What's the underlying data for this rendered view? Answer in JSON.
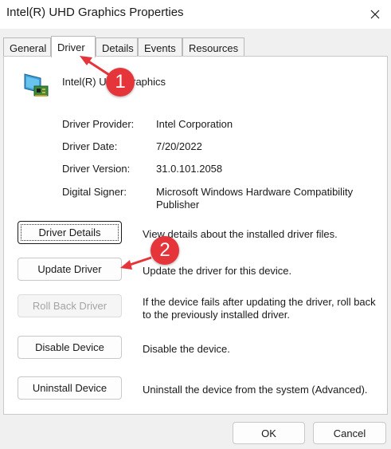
{
  "window": {
    "title": "Intel(R) UHD Graphics Properties"
  },
  "tabs": [
    {
      "label": "General"
    },
    {
      "label": "Driver"
    },
    {
      "label": "Details"
    },
    {
      "label": "Events"
    },
    {
      "label": "Resources"
    }
  ],
  "device": {
    "name": "Intel(R) UHD Graphics",
    "icon": "display-adapter-icon"
  },
  "info": {
    "provider_label": "Driver Provider:",
    "provider_value": "Intel Corporation",
    "date_label": "Driver Date:",
    "date_value": "7/20/2022",
    "version_label": "Driver Version:",
    "version_value": "31.0.101.2058",
    "signer_label": "Digital Signer:",
    "signer_value": "Microsoft Windows Hardware Compatibility Publisher"
  },
  "actions": {
    "details_label": "Driver Details",
    "details_desc": "View details about the installed driver files.",
    "update_label": "Update Driver",
    "update_desc": "Update the driver for this device.",
    "rollback_label": "Roll Back Driver",
    "rollback_desc": "If the device fails after updating the driver, roll back to the previously installed driver.",
    "disable_label": "Disable Device",
    "disable_desc": "Disable the device.",
    "uninstall_label": "Uninstall Device",
    "uninstall_desc": "Uninstall the device from the system (Advanced)."
  },
  "footer": {
    "ok_label": "OK",
    "cancel_label": "Cancel"
  },
  "annotations": {
    "step1": "1",
    "step2": "2",
    "color": "#e5353a"
  }
}
